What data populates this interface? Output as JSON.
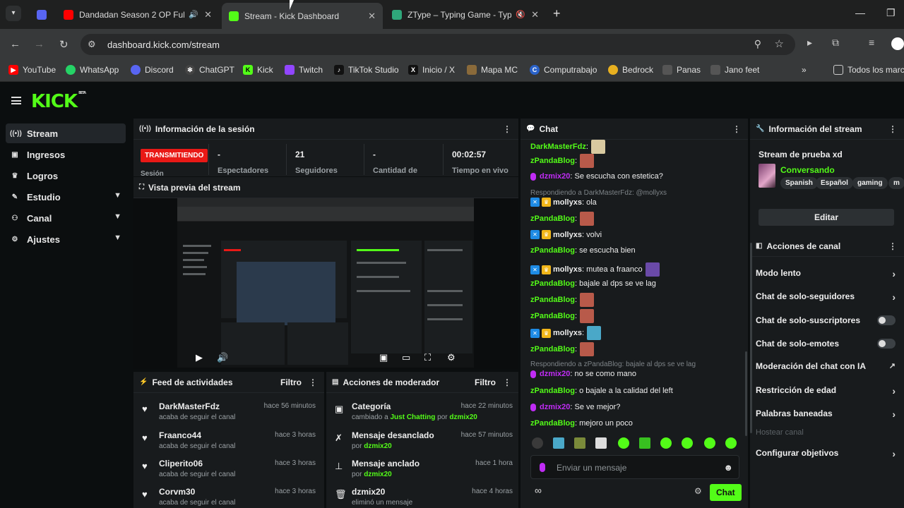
{
  "browser": {
    "tabs": [
      {
        "title": "Dandadan Season 2 OP Ful",
        "sound": "🔊"
      },
      {
        "title": "Stream - Kick Dashboard"
      },
      {
        "title": "ZType – Typing Game - Typ",
        "sound": "🔇"
      }
    ],
    "url": "dashboard.kick.com/stream",
    "bookmarks": [
      "YouTube",
      "WhatsApp",
      "Discord",
      "ChatGPT",
      "Kick",
      "Twitch",
      "TikTok Studio",
      "Inicio / X",
      "Mapa MC",
      "Computrabajo",
      "Bedrock",
      "Panas",
      "Jano feet",
      "Todos los marc"
    ]
  },
  "app": {
    "logo": "KICK",
    "logo_sup": "BETA"
  },
  "sidebar": {
    "items": [
      {
        "label": "Stream",
        "icon": "broadcast-icon"
      },
      {
        "label": "Ingresos",
        "icon": "money-icon"
      },
      {
        "label": "Logros",
        "icon": "trophy-icon"
      },
      {
        "label": "Estudio",
        "icon": "studio-icon"
      },
      {
        "label": "Canal",
        "icon": "people-icon"
      },
      {
        "label": "Ajustes",
        "icon": "gear-icon"
      }
    ]
  },
  "session": {
    "title": "Información de la sesión",
    "badge": "TRANSMITIENDO",
    "badge_label": "Sesión",
    "stats": [
      {
        "value": "-",
        "label": "Espectadores"
      },
      {
        "value": "21",
        "label": "Seguidores"
      },
      {
        "value": "-",
        "label": "Cantidad de"
      },
      {
        "value": "00:02:57",
        "label": "Tiempo en vivo"
      }
    ]
  },
  "preview": {
    "title": "Vista previa del stream"
  },
  "feed": {
    "title": "Feed de actividades",
    "filter": "Filtro",
    "items": [
      {
        "name": "DarkMasterFdz",
        "sub": "acaba de seguir el canal",
        "time": "hace 56 minutos"
      },
      {
        "name": "Fraanco44",
        "sub": "acaba de seguir el canal",
        "time": "hace 3 horas"
      },
      {
        "name": "Cliperito06",
        "sub": "acaba de seguir el canal",
        "time": "hace 3 horas"
      },
      {
        "name": "Corvm30",
        "sub": "acaba de seguir el canal",
        "time": "hace 3 horas"
      }
    ]
  },
  "mod": {
    "title": "Acciones de moderador",
    "filter": "Filtro",
    "items": [
      {
        "name": "Categoría",
        "sub_a": "cambiado a ",
        "sub_b": "Just Chatting",
        "sub_c": " por ",
        "sub_d": "dzmix20",
        "time": "hace 22 minutos"
      },
      {
        "name": "Mensaje desanclado",
        "sub_a": "por ",
        "sub_d": "dzmix20",
        "time": "hace 57 minutos"
      },
      {
        "name": "Mensaje anclado",
        "sub_a": "por ",
        "sub_d": "dzmix20",
        "time": "hace 1 hora"
      },
      {
        "name": "dzmix20",
        "sub_a": "eliminó un mensaje",
        "time": "hace 4 horas"
      }
    ]
  },
  "chat": {
    "title": "Chat",
    "messages": [
      {
        "user": "DarkMasterFdz",
        "text": ":",
        "color": "#53fc18"
      },
      {
        "user": "zPandaBlog",
        "text": ":",
        "color": "#53fc18"
      },
      {
        "user": "dzmix20",
        "text": ": Se escucha con estetica?",
        "color": "#c02cf5"
      },
      {
        "reply": "Respondiendo a DarkMasterFdz: @mollyxs"
      },
      {
        "user": "mollyxs",
        "text": ": ola",
        "color": "#eee"
      },
      {
        "user": "zPandaBlog",
        "text": ":",
        "color": "#53fc18"
      },
      {
        "user": "mollyxs",
        "text": ": volvi",
        "color": "#eee"
      },
      {
        "user": "zPandaBlog",
        "text": ": se escucha bien",
        "color": "#53fc18"
      },
      {
        "user": "mollyxs",
        "text": ": mutea a fraanco",
        "color": "#eee"
      },
      {
        "user": "zPandaBlog",
        "text": ": bajale al dps se ve lag",
        "color": "#53fc18"
      },
      {
        "user": "zPandaBlog",
        "text": ":",
        "color": "#53fc18"
      },
      {
        "user": "zPandaBlog",
        "text": ":",
        "color": "#53fc18"
      },
      {
        "user": "mollyxs",
        "text": ":",
        "color": "#eee"
      },
      {
        "user": "zPandaBlog",
        "text": ":",
        "color": "#53fc18"
      },
      {
        "reply": "Respondiendo a zPandaBlog: bajale al dps se ve lag"
      },
      {
        "user": "dzmix20",
        "text": ": no se como mano",
        "color": "#c02cf5"
      },
      {
        "user": "zPandaBlog",
        "text": ": o bajale a la calidad del left",
        "color": "#53fc18"
      },
      {
        "user": "dzmix20",
        "text": ": Se ve mejor?",
        "color": "#c02cf5"
      },
      {
        "user": "zPandaBlog",
        "text": ": mejoro un poco",
        "color": "#53fc18"
      }
    ],
    "placeholder": "Enviar un mensaje",
    "send": "Chat"
  },
  "stream_info": {
    "title": "Información del stream",
    "stream_title": "Stream de prueba xd",
    "category": "Conversando",
    "tags": [
      "Spanish",
      "Español",
      "gaming",
      "m"
    ],
    "edit": "Editar"
  },
  "channel_actions": {
    "title": "Acciones de canal",
    "items": [
      {
        "label": "Modo lento",
        "ctl": "arrow"
      },
      {
        "label": "Chat de solo-seguidores",
        "ctl": "arrow"
      },
      {
        "label": "Chat de solo-suscriptores",
        "ctl": "toggle"
      },
      {
        "label": "Chat de solo-emotes",
        "ctl": "toggle"
      },
      {
        "label": "Moderación del chat con IA",
        "ctl": "ext"
      },
      {
        "label": "Restricción de edad",
        "ctl": "arrow"
      },
      {
        "label": "Palabras baneadas",
        "ctl": "arrow"
      },
      {
        "label": "Hostear canal",
        "ctl": "none"
      },
      {
        "label": "Configurar objetivos",
        "ctl": "arrow"
      }
    ]
  }
}
